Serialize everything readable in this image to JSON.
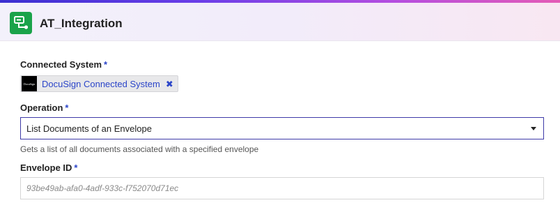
{
  "header": {
    "title": "AT_Integration",
    "icon": "integration-icon",
    "accent": "#1aa34a"
  },
  "connected_system": {
    "label": "Connected System",
    "required_marker": "*",
    "chip_text": "DocuSign Connected System",
    "chip_logo_text": "DocuSign",
    "remove_glyph": "✖"
  },
  "operation": {
    "label": "Operation",
    "required_marker": "*",
    "selected": "List Documents of an Envelope",
    "help_text": "Gets a list of all documents associated with a specified envelope"
  },
  "envelope_id": {
    "label": "Envelope ID",
    "required_marker": "*",
    "placeholder": "93be49ab-afa0-4adf-933c-f752070d71ec"
  },
  "colors": {
    "link_blue": "#2b45c9",
    "select_border": "#3e3aa8"
  }
}
